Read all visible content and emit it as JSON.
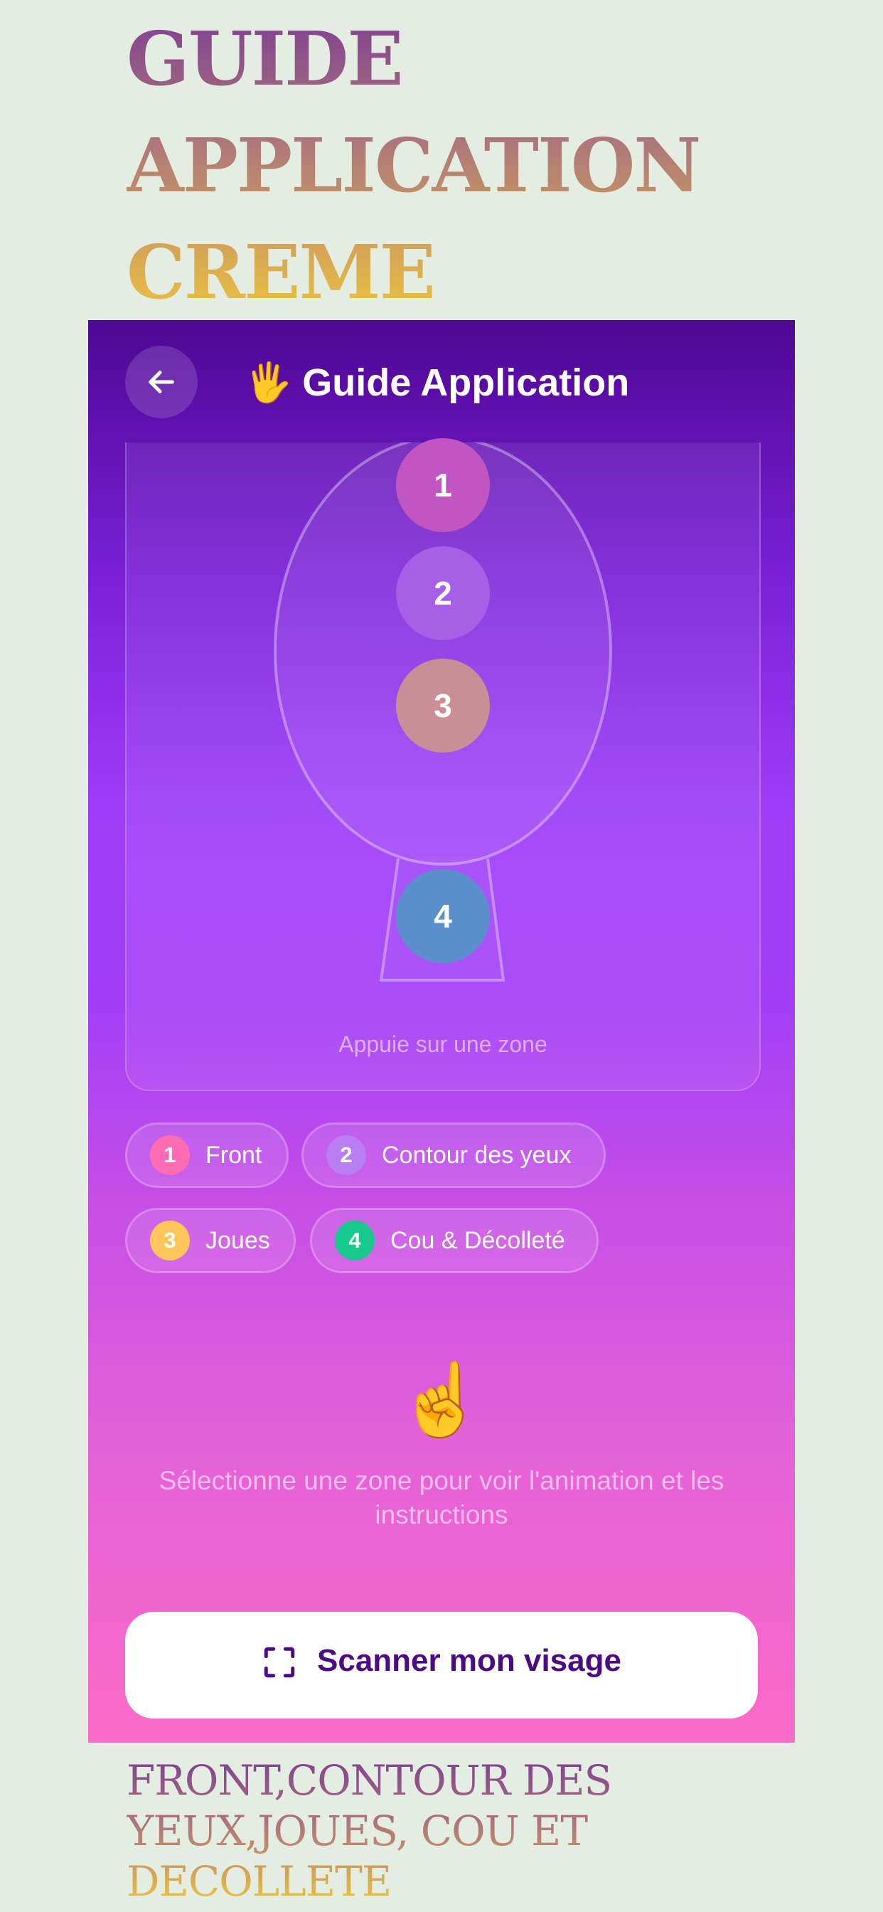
{
  "hero": {
    "title": "GUIDE APPLICATION CREME"
  },
  "header": {
    "back_icon": "arrow-left-icon",
    "emoji": "🖐",
    "title": "Guide Application"
  },
  "face_card": {
    "zones": [
      {
        "number": "1",
        "color": "#c156c2"
      },
      {
        "number": "2",
        "color": "#a65fe6"
      },
      {
        "number": "3",
        "color": "#c98f95"
      },
      {
        "number": "4",
        "color": "#5a8fcc"
      }
    ],
    "hint": "Appuie sur une zone"
  },
  "legend": [
    {
      "number": "1",
      "label": "Front",
      "color": "#ff6cb4"
    },
    {
      "number": "2",
      "label": "Contour des yeux",
      "color": "#b97ef2"
    },
    {
      "number": "3",
      "label": "Joues",
      "color": "#ffc65a"
    },
    {
      "number": "4",
      "label": "Cou & Décolleté",
      "color": "#17c98d"
    }
  ],
  "empty_state": {
    "emoji": "☝️",
    "text": "Sélectionne une zone pour voir l'animation et les instructions"
  },
  "scan_button": {
    "icon": "scan-frame-icon",
    "label": "Scanner mon visage"
  },
  "footer": {
    "text": "FRONT,CONTOUR DES YEUX,JOUES, COU ET DECOLLETE"
  }
}
